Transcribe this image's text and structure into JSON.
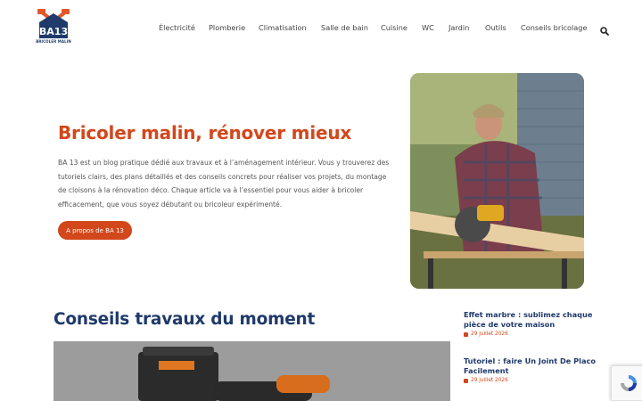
{
  "header": {
    "logo_text": "BA13",
    "logo_tagline": "BRICOLER MALIN",
    "nav": [
      {
        "label": "Électricité"
      },
      {
        "label": "Plomberie"
      },
      {
        "label": "Climatisation"
      },
      {
        "label": "Salle de bain"
      },
      {
        "label": "Cuisine"
      },
      {
        "label": "WC"
      },
      {
        "label": "Jardin"
      },
      {
        "label": "Outils"
      },
      {
        "label": "Conseils bricolage"
      }
    ],
    "search_icon": "search-icon"
  },
  "hero": {
    "title": "Bricoler malin, rénover mieux",
    "text": "BA 13 est un blog pratique dédié aux travaux et à l’aménagement intérieur. Vous y trouverez des tutoriels clairs, des plans détaillés et des conseils concrets pour réaliser vos projets, du montage de cloisons à la rénovation déco. Chaque article va à l’essentiel pour vous aider à bricoler efficacement, que vous soyez débutant ou bricoleur expérimenté.",
    "button_label": "A propos de BA 13"
  },
  "section": {
    "title": "Conseils travaux du moment"
  },
  "side_posts": [
    {
      "title": "Effet marbre : sublimez chaque pièce de votre maison",
      "date": "29 juillet 2026"
    },
    {
      "title": "Tutoriel : faire Un Joint De Placo Facilement",
      "date": "29 juillet 2026"
    }
  ],
  "colors": {
    "accent": "#d2471b",
    "navy": "#1f3a6b"
  }
}
